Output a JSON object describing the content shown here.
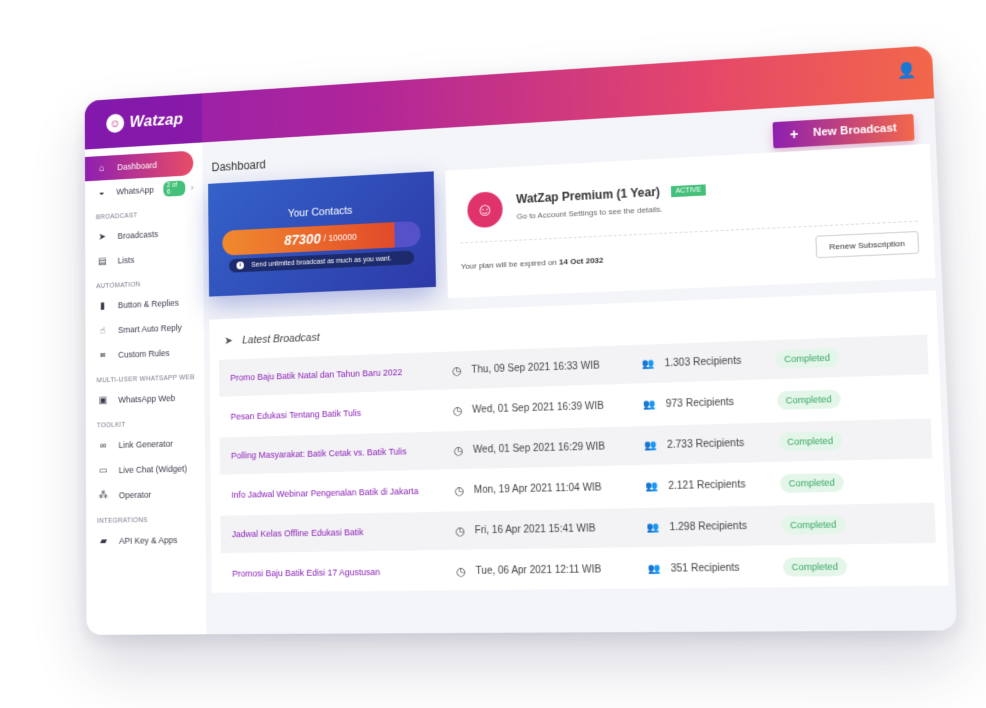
{
  "brand": {
    "name": "Watzap",
    "logo_icon": "smile-logo-icon"
  },
  "header": {
    "user_icon": "user-icon"
  },
  "sidebar": {
    "items": [
      {
        "label": "Dashboard",
        "icon": "home-icon",
        "active": true
      },
      {
        "label": "WhatsApp",
        "icon": "wifi-icon",
        "badge": "2 of 6"
      }
    ],
    "sections": [
      {
        "title": "Broadcast",
        "items": [
          {
            "label": "Broadcasts",
            "icon": "send-icon"
          },
          {
            "label": "Lists",
            "icon": "list-icon"
          }
        ]
      },
      {
        "title": "Automation",
        "items": [
          {
            "label": "Button & Replies",
            "icon": "button-icon"
          },
          {
            "label": "Smart Auto Reply",
            "icon": "auto-reply-icon"
          },
          {
            "label": "Custom Rules",
            "icon": "rules-icon"
          }
        ]
      },
      {
        "title": "Multi-user WhatsApp Web",
        "items": [
          {
            "label": "WhatsApp Web",
            "icon": "web-icon"
          }
        ]
      },
      {
        "title": "Toolkit",
        "items": [
          {
            "label": "Link Generator",
            "icon": "link-icon"
          },
          {
            "label": "Live Chat (Widget)",
            "icon": "chat-icon"
          },
          {
            "label": "Operator",
            "icon": "operator-icon"
          }
        ]
      },
      {
        "title": "Integrations",
        "items": [
          {
            "label": "API Key & Apps",
            "icon": "api-icon"
          }
        ]
      }
    ]
  },
  "main": {
    "page_title": "Dashboard",
    "new_broadcast_label": "New Broadcast"
  },
  "contacts": {
    "title": "Your Contacts",
    "count": "87300",
    "max": "/ 100000",
    "fill_fraction": 0.873,
    "note": "Send unlimited broadcast as much as you want."
  },
  "plan": {
    "name": "WatZap Premium (1 Year)",
    "status": "ACTIVE",
    "subtitle": "Go to Account Settings to see the details.",
    "expiry_text": "Your plan will be expired on",
    "expiry_date": "14 Oct 2032",
    "renew_label": "Renew Subscription"
  },
  "broadcast": {
    "title": "Latest Broadcast",
    "rows": [
      {
        "name": "Promo Baju Batik Natal dan Tahun Baru 2022",
        "date": "Thu, 09 Sep 2021 16:33 WIB",
        "recipients": "1.303 Recipients",
        "status": "Completed"
      },
      {
        "name": "Pesan Edukasi Tentang Batik Tulis",
        "date": "Wed, 01 Sep 2021 16:39 WIB",
        "recipients": "973 Recipients",
        "status": "Completed"
      },
      {
        "name": "Polling Masyarakat: Batik Cetak vs. Batik Tulis",
        "date": "Wed, 01 Sep 2021 16:29 WIB",
        "recipients": "2.733 Recipients",
        "status": "Completed"
      },
      {
        "name": "Info Jadwal Webinar Pengenalan Batik di Jakarta",
        "date": "Mon, 19 Apr 2021 11:04 WIB",
        "recipients": "2.121 Recipients",
        "status": "Completed"
      },
      {
        "name": "Jadwal Kelas Offline Edukasi Batik",
        "date": "Fri, 16 Apr 2021 15:41 WIB",
        "recipients": "1.298 Recipients",
        "status": "Completed"
      },
      {
        "name": "Promosi Baju Batik Edisi 17 Agustusan",
        "date": "Tue, 06 Apr 2021 12:11 WIB",
        "recipients": "351 Recipients",
        "status": "Completed"
      }
    ]
  }
}
